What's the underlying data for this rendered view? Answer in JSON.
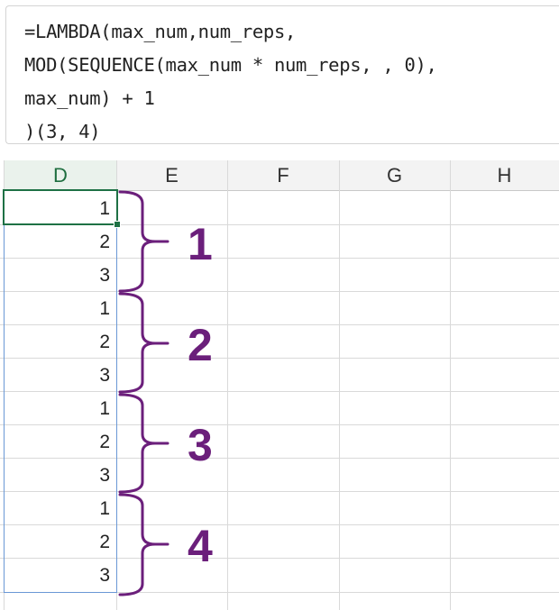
{
  "formula": {
    "lines": [
      "=LAMBDA(max_num,num_reps,",
      "MOD(SEQUENCE(max_num * num_reps, , 0),",
      "max_num) + 1",
      ")(3, 4)"
    ]
  },
  "columns": [
    "D",
    "E",
    "F",
    "G",
    "H"
  ],
  "column_d_values": [
    "1",
    "2",
    "3",
    "1",
    "2",
    "3",
    "1",
    "2",
    "3",
    "1",
    "2",
    "3"
  ],
  "annotations": {
    "group_labels": [
      "1",
      "2",
      "3",
      "4"
    ],
    "color": "#6b1f7b"
  },
  "colors": {
    "active_column": "#1e7145",
    "range_border": "#6a98d6"
  }
}
